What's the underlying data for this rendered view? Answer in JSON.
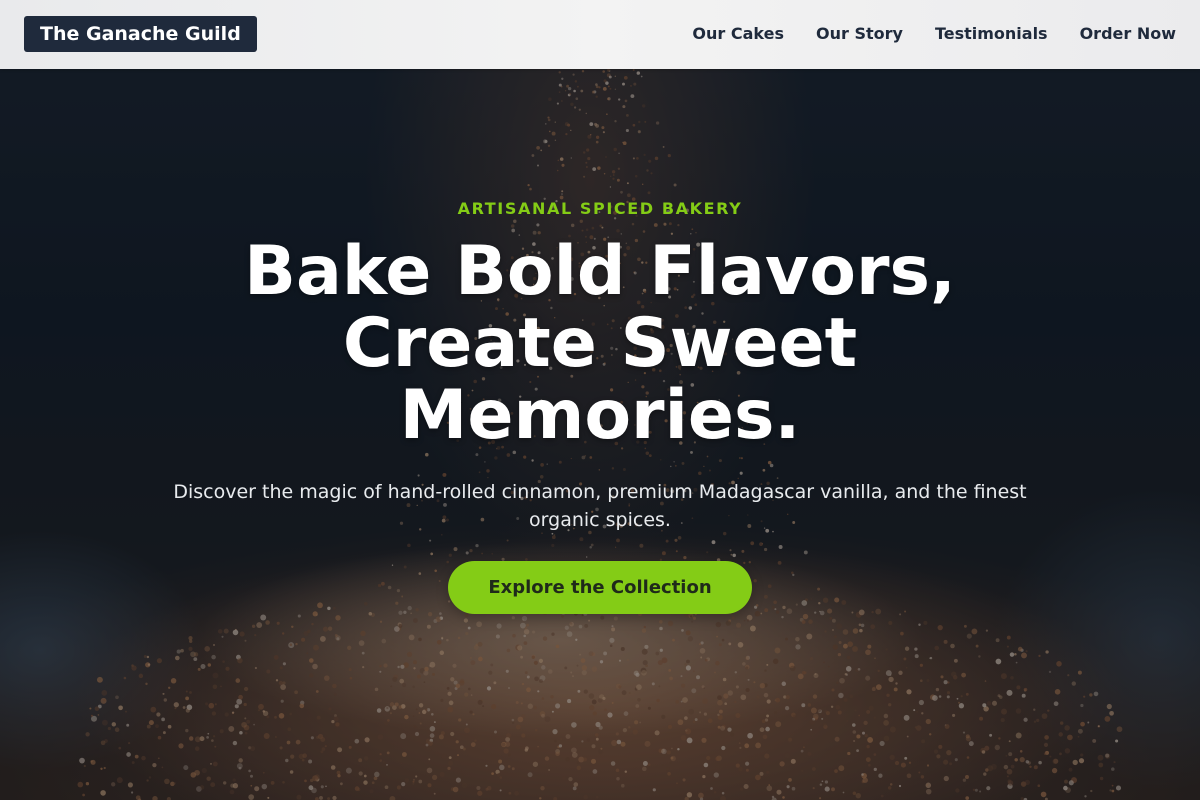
{
  "header": {
    "logo_text": "The Ganache Guild",
    "nav": [
      {
        "label": "Our Cakes"
      },
      {
        "label": "Our Story"
      },
      {
        "label": "Testimonials"
      },
      {
        "label": "Order Now"
      }
    ]
  },
  "hero": {
    "eyebrow": "ARTISANAL SPICED BAKERY",
    "headline": "Bake Bold Flavors, Create Sweet Memories.",
    "subhead": "Discover the magic of hand-rolled cinnamon, premium Madagascar vanilla, and the finest organic spices.",
    "cta_label": "Explore the Collection",
    "background_image": "spices-falling-into-bowl-photo"
  },
  "colors": {
    "brand_dark": "#1f2a3c",
    "accent_green": "#84cc16",
    "header_bg": "#f0f0f1",
    "headline_text": "#ffffff"
  }
}
